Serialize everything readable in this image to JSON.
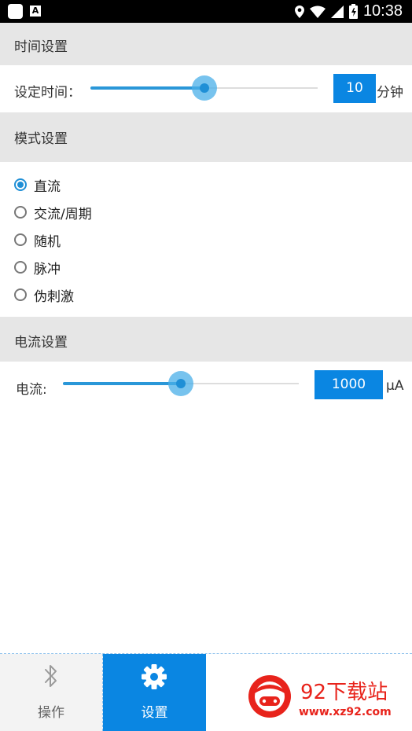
{
  "status_bar": {
    "time": "10:38",
    "notification_letter": "A"
  },
  "time_section": {
    "title": "时间设置",
    "label": "设定时间：",
    "value": "10",
    "unit": "分钟",
    "slider_fraction": 0.5
  },
  "mode_section": {
    "title": "模式设置",
    "options": [
      {
        "label": "直流",
        "selected": true
      },
      {
        "label": "交流/周期",
        "selected": false
      },
      {
        "label": "随机",
        "selected": false
      },
      {
        "label": "脉冲",
        "selected": false
      },
      {
        "label": "伪刺激",
        "selected": false
      }
    ]
  },
  "current_section": {
    "title": "电流设置",
    "label": "电流:",
    "value": "1000",
    "unit": "μA",
    "slider_fraction": 0.5
  },
  "bottom_nav": {
    "tabs": [
      {
        "label": "操作",
        "icon": "bluetooth-icon",
        "active": false
      },
      {
        "label": "设置",
        "icon": "gear-icon",
        "active": true
      }
    ]
  },
  "watermark": {
    "title": "92下载站",
    "url": "www.xz92.com"
  },
  "colors": {
    "accent": "#0a86e2",
    "slider": "#2a97d8",
    "header_bg": "#e6e6e6"
  }
}
